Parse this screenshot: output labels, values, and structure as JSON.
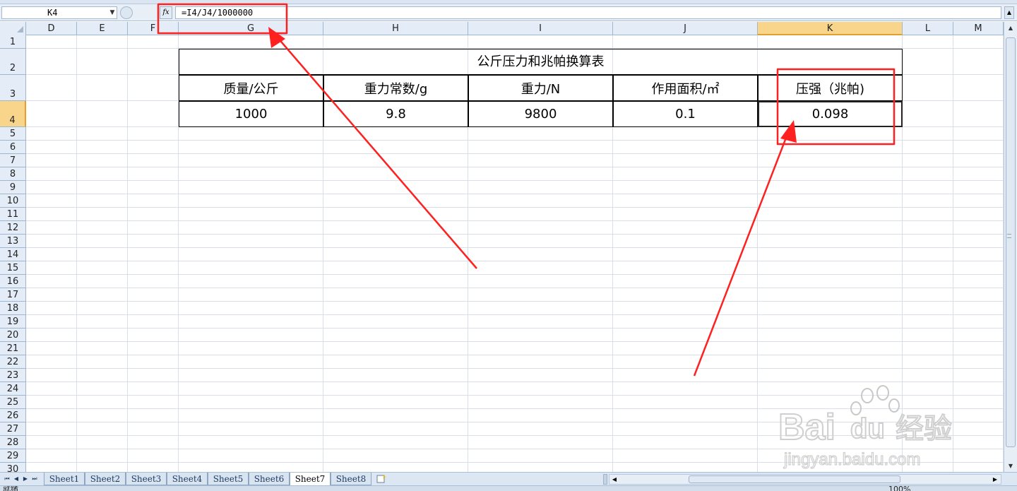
{
  "formula_bar": {
    "name_box": "K4",
    "fx_label": "fx",
    "formula": "=I4/J4/1000000"
  },
  "columns": [
    {
      "label": "D"
    },
    {
      "label": "E"
    },
    {
      "label": "F"
    },
    {
      "label": "G"
    },
    {
      "label": "H"
    },
    {
      "label": "I"
    },
    {
      "label": "J"
    },
    {
      "label": "K",
      "selected": true
    },
    {
      "label": "L"
    },
    {
      "label": "M"
    }
  ],
  "rows": [
    "1",
    "2",
    "3",
    "4",
    "5",
    "6",
    "7",
    "8",
    "9",
    "10",
    "11",
    "12",
    "13",
    "14",
    "15",
    "16",
    "17",
    "18",
    "19",
    "20",
    "21",
    "22",
    "23",
    "24",
    "25",
    "26",
    "27",
    "28",
    "29",
    "30"
  ],
  "selected_row": "4",
  "table": {
    "title": "公斤压力和兆帕换算表",
    "headers": [
      "质量/公斤",
      "重力常数/g",
      "重力/N",
      "作用面积/㎡",
      "压强（兆帕)"
    ],
    "values": [
      "1000",
      "9.8",
      "9800",
      "0.1",
      "0.098"
    ]
  },
  "sheet_tabs": [
    {
      "label": "Sheet1"
    },
    {
      "label": "Sheet2"
    },
    {
      "label": "Sheet3"
    },
    {
      "label": "Sheet4"
    },
    {
      "label": "Sheet5"
    },
    {
      "label": "Sheet6"
    },
    {
      "label": "Sheet7",
      "active": true
    },
    {
      "label": "Sheet8"
    }
  ],
  "status": {
    "ready": "就绪",
    "zoom": "100%"
  },
  "watermark": {
    "brand": "Bai",
    "brand_du": "du",
    "brand_cn": "经验",
    "url": "jingyan.baidu.com"
  },
  "annotation_color": "#ff2020"
}
